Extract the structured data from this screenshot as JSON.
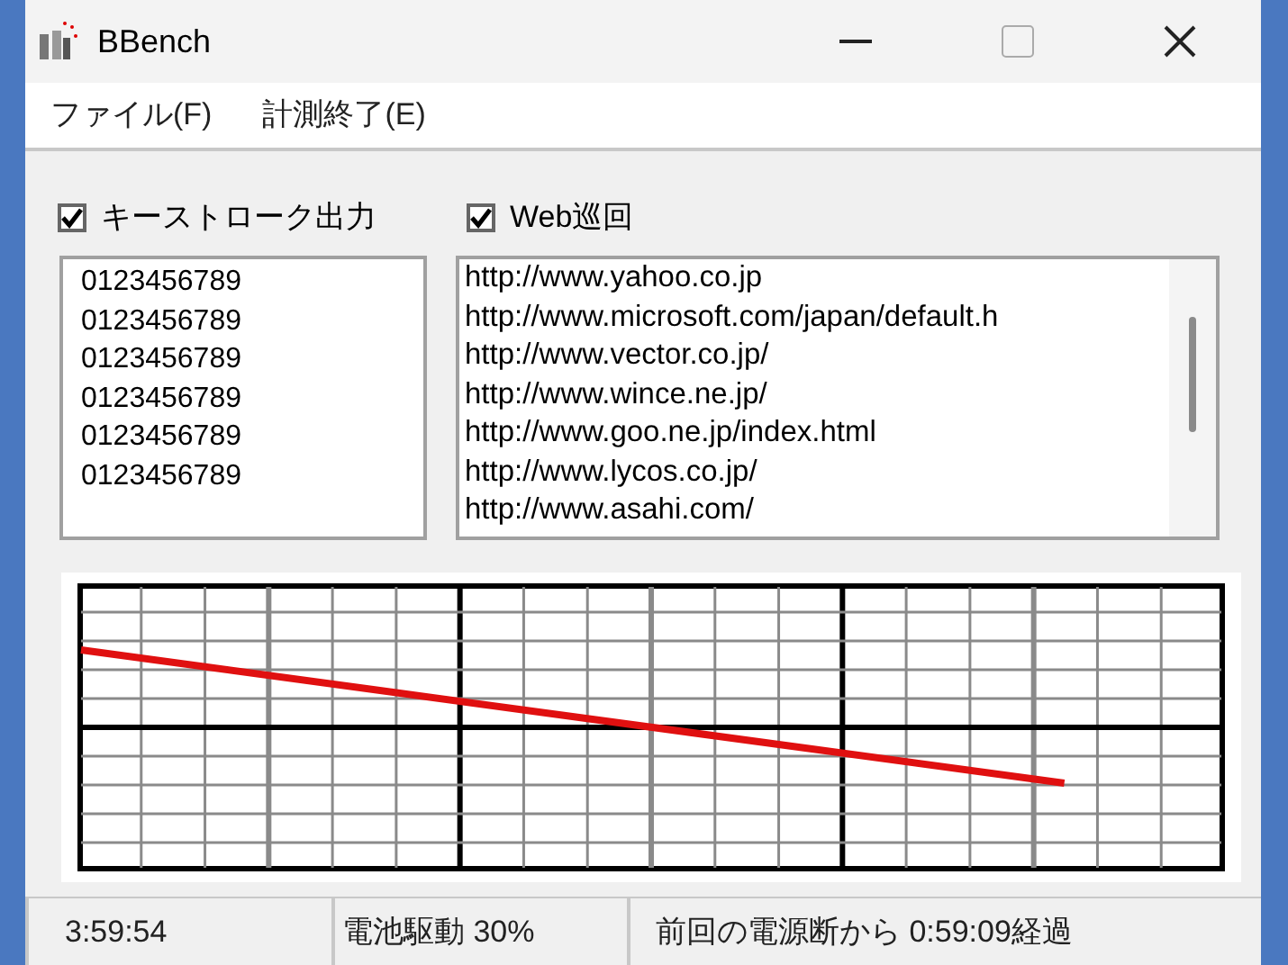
{
  "window": {
    "title": "BBench"
  },
  "menu": [
    "ファイル(F)",
    "計測終了(E)"
  ],
  "options": [
    {
      "label": "キーストローク出力",
      "checked": true
    },
    {
      "label": "Web巡回",
      "checked": true
    }
  ],
  "keystrokes": [
    "0123456789",
    "0123456789",
    "0123456789",
    "0123456789",
    "0123456789",
    "0123456789"
  ],
  "urls": [
    "http://www.yahoo.co.jp",
    "http://www.microsoft.com/japan/default.h",
    "http://www.vector.co.jp/",
    "http://www.wince.ne.jp/",
    "http://www.goo.ne.jp/index.html",
    "http://www.lycos.co.jp/",
    "http://www.asahi.com/"
  ],
  "status_bar": [
    "3:59:54",
    "電池駆動  30%",
    "前回の電源断から 0:59:09経過"
  ]
}
